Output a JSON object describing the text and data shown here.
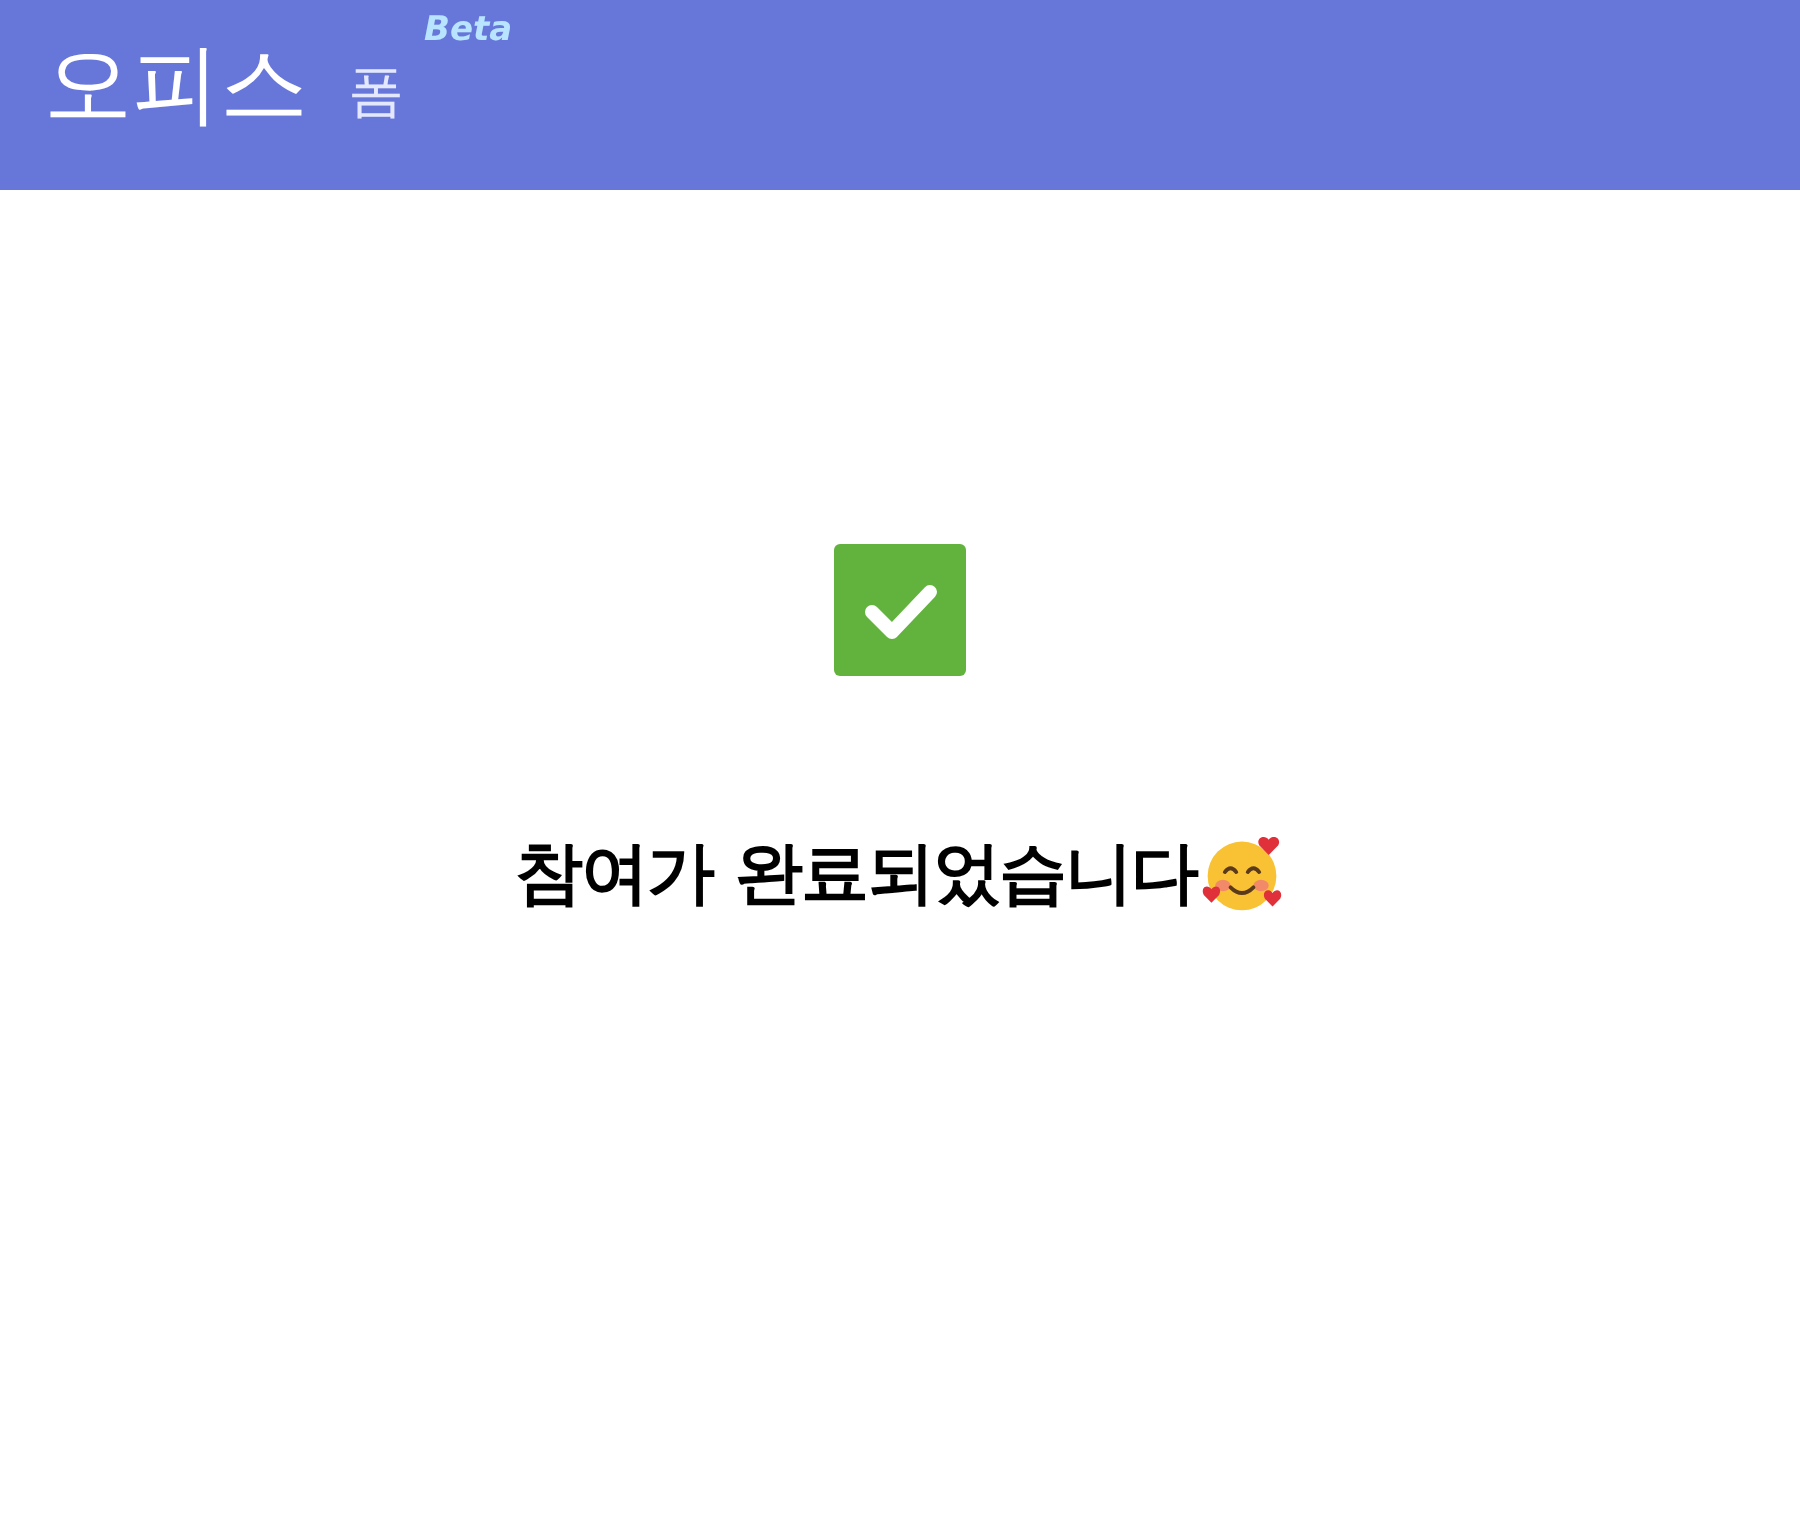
{
  "header": {
    "logo": "오피스",
    "product": "폼",
    "badge": "Beta"
  },
  "message": "참여가 완료되었습니다"
}
